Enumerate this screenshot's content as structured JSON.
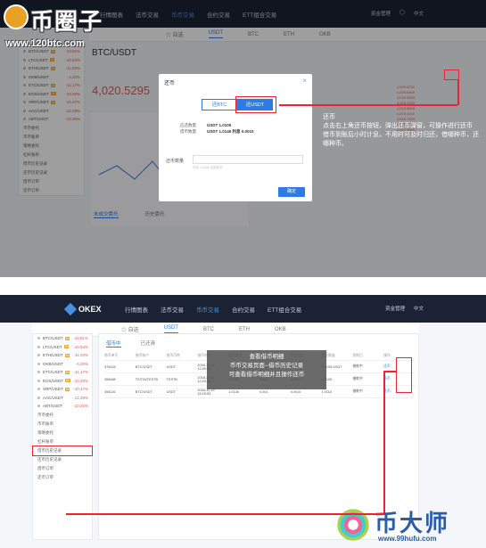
{
  "watermarks": {
    "top_logo": "币圈子",
    "top_url": "www.120btc.com",
    "bottom_logo": "币大师",
    "bottom_url": "www.99hufu.com"
  },
  "top_panel": {
    "nav": {
      "items": [
        "行情图表",
        "法币交易",
        "币币交易",
        "合约交易",
        "ETT组合交易"
      ],
      "active_index": 2,
      "right_items": [
        "资金管理",
        "◯",
        "中文"
      ]
    },
    "subtabs": [
      "☆ 自选",
      "USDT",
      "BTC",
      "ETH",
      "OKB"
    ],
    "subtabs_active": 1,
    "pair_title": "BTC/USDT",
    "price": "4,020.5295",
    "sidebar_items": [
      {
        "pair": "BTC/USDT",
        "tag": "3x",
        "chg": "-10.81%"
      },
      {
        "pair": "LTC/USDT",
        "tag": "3x",
        "chg": "-10.94%"
      },
      {
        "pair": "ETH/USDT",
        "tag": "3x",
        "chg": "-11.03%"
      },
      {
        "pair": "OKB/USDT",
        "tag": "",
        "chg": "-4.20%"
      },
      {
        "pair": "ETC/USDT",
        "tag": "3x",
        "chg": "-11.17%"
      },
      {
        "pair": "EOS/USDT",
        "tag": "3x",
        "chg": "-10.46%"
      },
      {
        "pair": "XRP/USDT",
        "tag": "3x",
        "chg": "-10.47%"
      },
      {
        "pair": "AAC/USDT",
        "tag": "",
        "chg": "-12.28%"
      },
      {
        "pair": "ABT/USDT",
        "tag": "",
        "chg": "-10.26%"
      }
    ],
    "sidebar_menu": [
      "币币委托",
      "币币账单",
      "策略委托",
      "杠杆账单",
      "借币历史记录",
      "还币历史记录",
      "借币订单",
      "还币订单"
    ],
    "orders_tabs": [
      "未成交委托",
      "历史委托"
    ],
    "modal": {
      "title": "还币",
      "close": "×",
      "seg_options": [
        "还BTC",
        "还USDT"
      ],
      "seg_active": 1,
      "info_lines": [
        {
          "label": "应还数量",
          "value": "USDT 1.0105"
        },
        {
          "label": "借币数量",
          "value": "USDT 1.0146  利息 0.0010"
        }
      ],
      "amount_label": "还币数量",
      "amount_hint": "可还 1.0105 全部还币",
      "confirm": "确定"
    },
    "callout_text": [
      "还币",
      "点击右上角还币按钮，弹出还币弹窗，可操作进行还币",
      "借币到账后小时计息，不用时可及时归还，借哪种币，还哪种币。"
    ]
  },
  "bottom_panel": {
    "brand": "OKEX",
    "nav": [
      "行情图表",
      "法币交易",
      "币币交易",
      "合约交易",
      "ETT组合交易"
    ],
    "nav_active_index": 2,
    "right_items": [
      "资金管理",
      "中文"
    ],
    "subtabs": [
      "☆ 自选",
      "USDT",
      "BTC",
      "ETH",
      "OKB"
    ],
    "subtabs_active": 1,
    "tabs": [
      "借币中",
      "已还清"
    ],
    "tabs_active": 0,
    "table_headers": [
      "借币单号",
      "借币账户",
      "借币币种",
      "借币时间",
      "借币数量",
      "日利率",
      "未还利息",
      "应还数量",
      "到期日",
      "操作"
    ],
    "table_rows": [
      [
        "376428",
        "BTC/USDT",
        "USDT",
        "2018-11-19 12:59:00",
        "1.0146",
        "0.002",
        "0.0010",
        "1.0105 USDT",
        "借款中",
        "还币"
      ],
      [
        "358488",
        "TESTA/TESTB",
        "TESTB",
        "2018-11-19 12:43:35",
        "1.0146",
        "0.001",
        "0.0010",
        "1.0105",
        "借款中",
        "还币"
      ],
      [
        "358116",
        "BTC/USDT",
        "USDT",
        "2018-11-19 15:18:53",
        "1.0106",
        "0.001",
        "0.0010",
        "1.0115",
        "借款中",
        "还币"
      ]
    ],
    "callout_lines": [
      "查看借币明细",
      "币币交易页面--借币历史记录",
      "可查看借币明细并且操作还币"
    ],
    "sidebar_highlight_item": "借币历史记录"
  }
}
